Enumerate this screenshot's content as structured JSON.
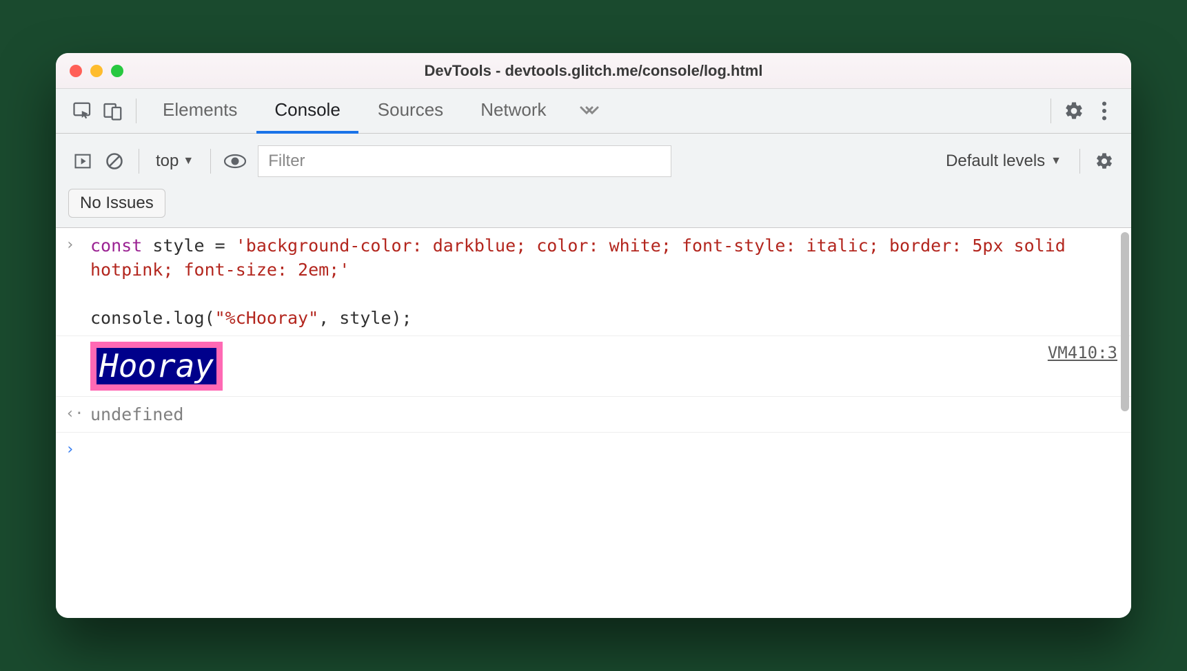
{
  "window": {
    "title": "DevTools - devtools.glitch.me/console/log.html"
  },
  "tabs": {
    "elements": "Elements",
    "console": "Console",
    "sources": "Sources",
    "network": "Network"
  },
  "toolbar": {
    "context": "top",
    "filter_placeholder": "Filter",
    "levels": "Default levels",
    "issues": "No Issues"
  },
  "console": {
    "input_code_1": "const",
    "input_code_2": " style = ",
    "input_code_3": "'background-color: darkblue; color: white; font-style: italic; border: 5px solid hotpink; font-size: 2em;'",
    "input_code_4": "console.log(",
    "input_code_5": "\"%cHooray\"",
    "input_code_6": ", style);",
    "styled_text": "Hooray",
    "source_ref": "VM410:3",
    "return_value": "undefined"
  }
}
